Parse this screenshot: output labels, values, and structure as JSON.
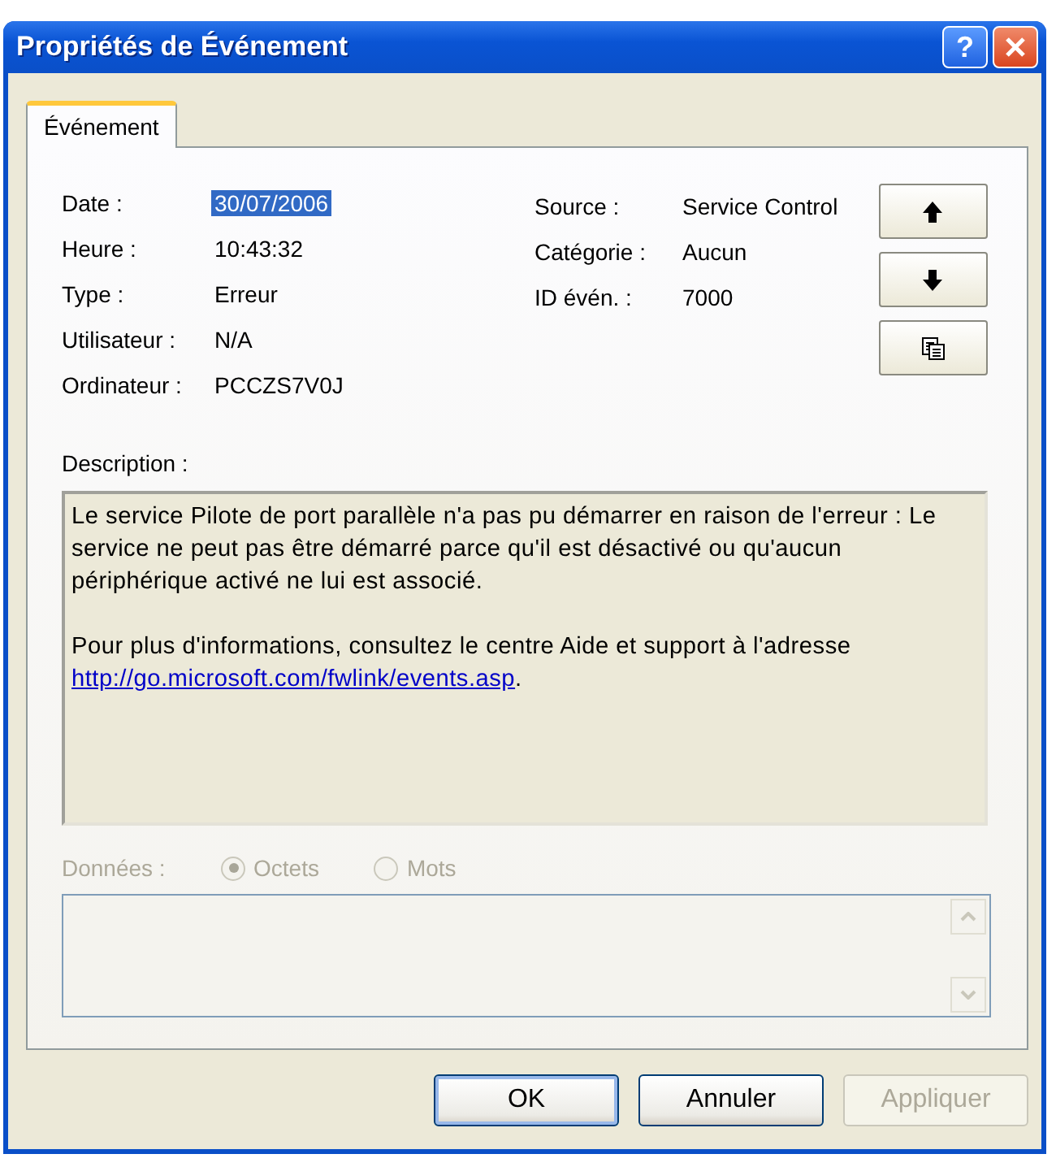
{
  "window": {
    "title": "Propriétés de Événement",
    "help_button": "?"
  },
  "tabs": [
    {
      "label": "Événement",
      "selected": true
    }
  ],
  "fields_left": [
    {
      "label": "Date :",
      "value": "30/07/2006",
      "highlighted": true
    },
    {
      "label": "Heure :",
      "value": "10:43:32",
      "highlighted": false
    },
    {
      "label": "Type :",
      "value": "Erreur",
      "highlighted": false
    },
    {
      "label": "Utilisateur :",
      "value": "N/A",
      "highlighted": false
    },
    {
      "label": "Ordinateur :",
      "value": "PCCZS7V0J",
      "highlighted": false
    }
  ],
  "fields_right": [
    {
      "label": "Source :",
      "value": "Service Control",
      "highlighted": false
    },
    {
      "label": "Catégorie :",
      "value": "Aucun",
      "highlighted": false
    },
    {
      "label": "ID évén. :",
      "value": "7000",
      "highlighted": false
    }
  ],
  "nav_buttons": [
    {
      "kind": "up"
    },
    {
      "kind": "down"
    },
    {
      "kind": "copy"
    }
  ],
  "description": {
    "label": "Description :",
    "paragraphs": [
      {
        "text": "Le service Pilote de port parallèle n'a pas pu démarrer en raison de l'erreur : Le service ne peut pas être démarré parce qu'il est désactivé ou qu'aucun périphérique activé ne lui est associé."
      },
      {
        "text": "Pour plus d'informations, consultez le centre Aide et support à l'adresse",
        "link": "http://go.microsoft.com/fwlink/events.asp",
        "suffix": "."
      }
    ]
  },
  "data": {
    "label": "Données :",
    "disabled": true,
    "options": [
      {
        "label": "Octets",
        "selected": true
      },
      {
        "label": "Mots",
        "selected": false
      }
    ]
  },
  "buttons": [
    {
      "label": "OK",
      "default": true,
      "disabled": false
    },
    {
      "label": "Annuler",
      "default": false,
      "disabled": false
    },
    {
      "label": "Appliquer",
      "default": false,
      "disabled": true
    }
  ]
}
